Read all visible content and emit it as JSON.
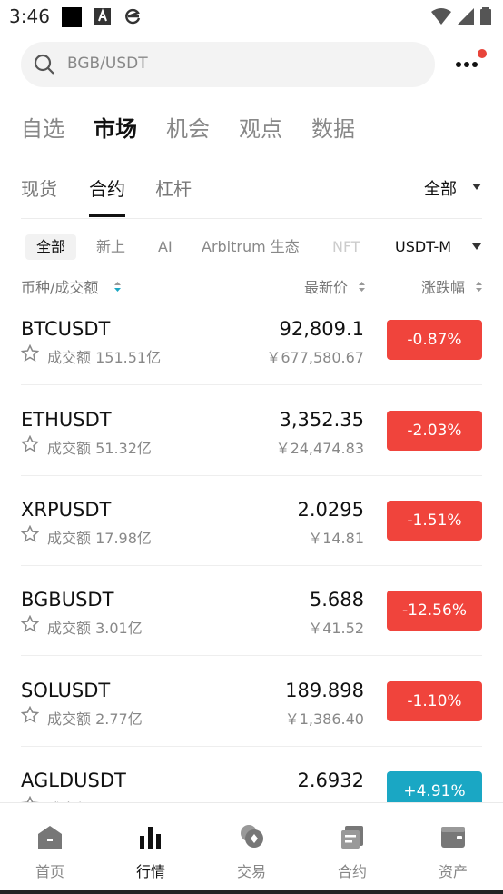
{
  "status_bar": {
    "time": "3:46"
  },
  "search": {
    "placeholder": "BGB/USDT"
  },
  "main_tabs": [
    {
      "label": "自选"
    },
    {
      "label": "市场"
    },
    {
      "label": "机会"
    },
    {
      "label": "观点"
    },
    {
      "label": "数据"
    }
  ],
  "sub_tabs": [
    {
      "label": "现货"
    },
    {
      "label": "合约"
    },
    {
      "label": "杠杆"
    }
  ],
  "filter": {
    "all_label": "全部"
  },
  "chips": [
    {
      "label": "全部"
    },
    {
      "label": "新上"
    },
    {
      "label": "AI"
    },
    {
      "label": "Arbitrum 生态"
    },
    {
      "label": "NFT"
    }
  ],
  "margin_type": "USDT-M",
  "columns": {
    "symbol_volume": "币种/成交额",
    "last_price": "最新价",
    "change": "涨跌幅"
  },
  "rows": [
    {
      "symbol": "BTCUSDT",
      "volume": "成交额 151.51亿",
      "price": "92,809.1",
      "cny": "￥677,580.67",
      "change": "-0.87%"
    },
    {
      "symbol": "ETHUSDT",
      "volume": "成交额 51.32亿",
      "price": "3,352.35",
      "cny": "￥24,474.83",
      "change": "-2.03%"
    },
    {
      "symbol": "XRPUSDT",
      "volume": "成交额 17.98亿",
      "price": "2.0295",
      "cny": "￥14.81",
      "change": "-1.51%"
    },
    {
      "symbol": "BGBUSDT",
      "volume": "成交额 3.01亿",
      "price": "5.688",
      "cny": "￥41.52",
      "change": "-12.56%"
    },
    {
      "symbol": "SOLUSDT",
      "volume": "成交额 2.77亿",
      "price": "189.898",
      "cny": "￥1,386.40",
      "change": "-1.10%"
    },
    {
      "symbol": "AGLDUSDT",
      "volume": "成交额",
      "price": "2.6932",
      "cny": "",
      "change": "+4.91%"
    }
  ],
  "nav": [
    {
      "label": "首页",
      "icon": "home-icon"
    },
    {
      "label": "行情",
      "icon": "market-chart-icon"
    },
    {
      "label": "交易",
      "icon": "trade-coin-icon"
    },
    {
      "label": "合约",
      "icon": "futures-icon"
    },
    {
      "label": "资产",
      "icon": "wallet-icon"
    }
  ],
  "colors": {
    "down": "#f0443c",
    "up": "#1aa7c4",
    "accent_red_dot": "#e8443a"
  }
}
